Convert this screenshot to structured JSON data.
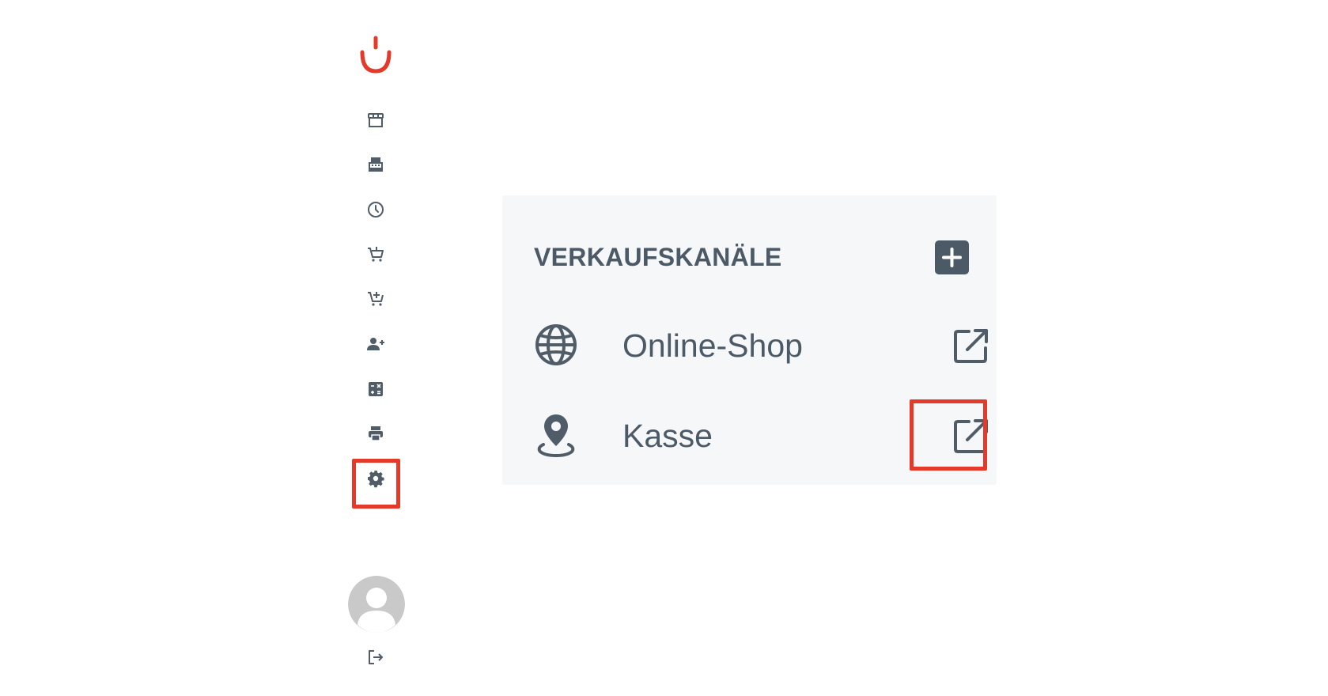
{
  "sidebar": {
    "logo": "smile-logo-icon",
    "items": [
      {
        "icon": "storefront-icon"
      },
      {
        "icon": "cash-register-icon"
      },
      {
        "icon": "clock-icon"
      },
      {
        "icon": "cart-icon"
      },
      {
        "icon": "cart-plus-icon"
      },
      {
        "icon": "user-plus-icon"
      },
      {
        "icon": "calculator-icon"
      },
      {
        "icon": "printer-icon"
      },
      {
        "icon": "gear-icon"
      }
    ],
    "avatar": "avatar-icon",
    "logout": "logout-icon"
  },
  "panel": {
    "title": "VERKAUFSKANÄLE",
    "add_icon": "plus-icon",
    "channels": [
      {
        "label": "Online-Shop",
        "icon": "globe-icon",
        "action_icon": "external-link-icon"
      },
      {
        "label": "Kasse",
        "icon": "map-pin-icon",
        "action_icon": "external-link-icon"
      }
    ]
  },
  "colors": {
    "accent": "#e5392a",
    "text": "#4b5a66",
    "icon": "#505d68",
    "panel_bg": "#f5f7f8",
    "highlight": "#e5392a"
  }
}
